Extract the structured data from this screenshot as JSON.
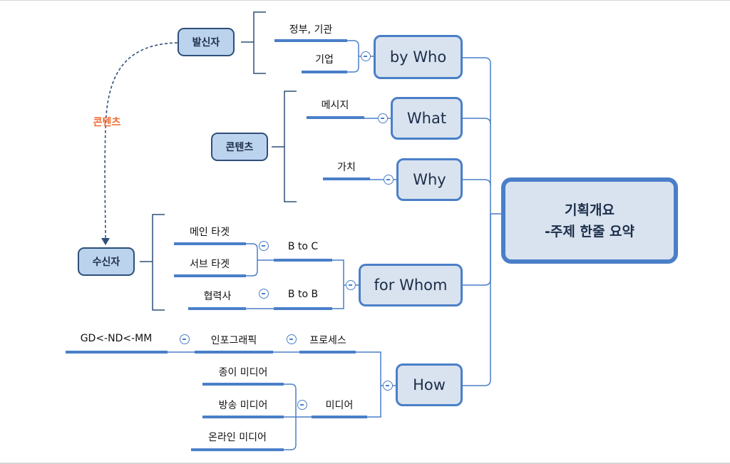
{
  "central": {
    "line1": "기획개요",
    "line2": "-주제 한줄 요약"
  },
  "main_topics": [
    {
      "id": "by-who",
      "label": "by Who"
    },
    {
      "id": "what",
      "label": "What"
    },
    {
      "id": "why",
      "label": "Why"
    },
    {
      "id": "for-whom",
      "label": "for Whom"
    },
    {
      "id": "how",
      "label": "How"
    }
  ],
  "subtopics": {
    "by_who": [
      "정부, 기관",
      "기업"
    ],
    "what": [
      "메시지"
    ],
    "why": [
      "가치"
    ],
    "for_whom": {
      "b_to_c": {
        "label": "B to C",
        "children": [
          "메인 타겟",
          "서브 타겟"
        ]
      },
      "b_to_b": {
        "label": "B to B",
        "children": [
          "협력사"
        ]
      }
    },
    "how": {
      "process": {
        "label": "프로세스",
        "child": "인포그래픽",
        "grandchild": "GD<-ND<-MM"
      },
      "media": {
        "label": "미디어",
        "children": [
          "종이 미디어",
          "방송 미디어",
          "온라인 미디어"
        ]
      }
    }
  },
  "floating_topics": {
    "sender": "발신자",
    "contents": "콘텐츠",
    "receiver": "수신자"
  },
  "relationship": {
    "label": "콘텐츠",
    "from": "발신자",
    "to": "수신자"
  },
  "colors": {
    "branch": "#4a7fc8",
    "node_fill": "#d9e3ef",
    "float_fill": "#bcd3ee",
    "float_border": "#2e4f79",
    "relationship_label": "#f26a2e"
  }
}
